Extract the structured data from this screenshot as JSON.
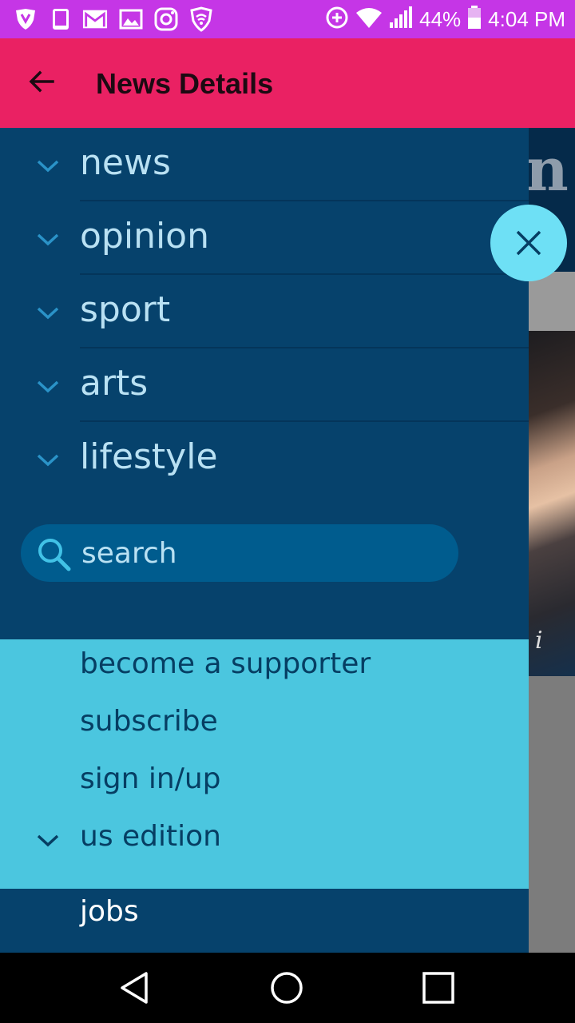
{
  "status_bar": {
    "icons": [
      "shield-icon",
      "tablet-icon",
      "gmail-icon",
      "image-icon",
      "instagram-icon",
      "wifi-shield-icon",
      "data-saver-icon",
      "wifi-icon",
      "signal-icon",
      "battery-icon"
    ],
    "battery": "44%",
    "time": "4:04 PM"
  },
  "app_bar": {
    "title": "News Details",
    "back_icon": "arrow-back-icon"
  },
  "background": {
    "masthead_letter": "n",
    "photo_caption_letter": "i"
  },
  "drawer": {
    "sections": [
      {
        "label": "news"
      },
      {
        "label": "opinion"
      },
      {
        "label": "sport"
      },
      {
        "label": "arts"
      },
      {
        "label": "lifestyle"
      }
    ],
    "search": {
      "placeholder": "search"
    },
    "secondary": {
      "become_supporter": "become a supporter",
      "subscribe": "subscribe",
      "sign_in": "sign in/up",
      "edition": "us edition"
    },
    "jobs": "jobs"
  },
  "fab": {
    "icon": "close-icon"
  },
  "nav_bar": {
    "back": "nav-back-icon",
    "home": "nav-home-icon",
    "recents": "nav-recents-icon"
  },
  "colors": {
    "status_bar": "#c536e6",
    "app_bar": "#ea2163",
    "drawer": "#06426c",
    "drawer_text": "#b9e1f3",
    "light_panel": "#4bc6df",
    "fab": "#6ee0f5"
  }
}
